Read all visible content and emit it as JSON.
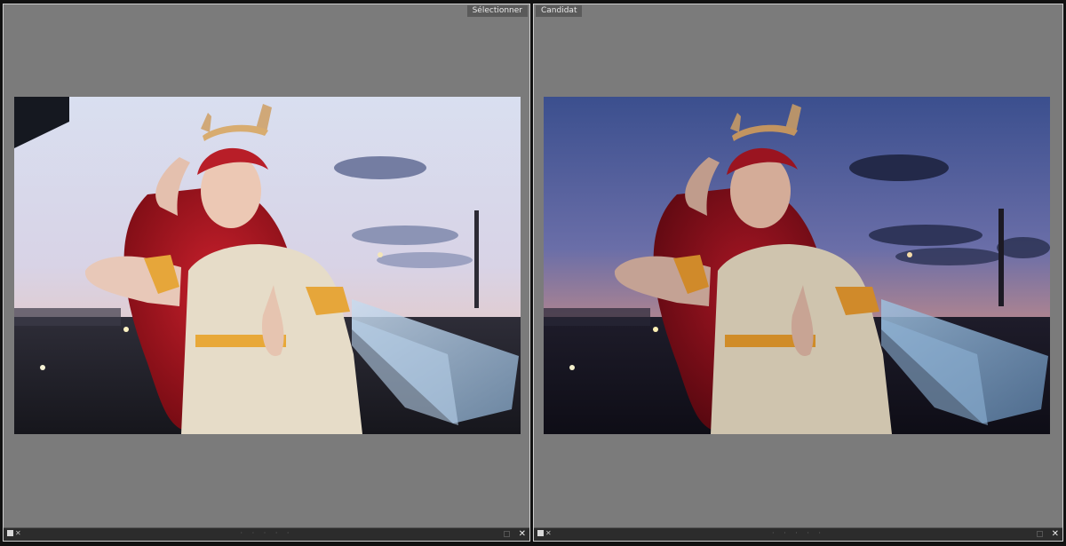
{
  "panes": {
    "left": {
      "label": "Sélectionner",
      "close_glyph": "✕",
      "flag_glyph": "✕",
      "dots": "· · · · ·"
    },
    "right": {
      "label": "Candidat",
      "close_glyph": "✕",
      "flag_glyph": "✕",
      "dots": "· · · · ·"
    }
  },
  "icons": {
    "flag": "flag-icon",
    "reject": "reject-x-icon",
    "rating_dots": "rating-dots-icon",
    "color_label": "color-label-icon",
    "close": "close-icon"
  },
  "colors": {
    "pane_bg": "#7b7b7b",
    "tag_bg": "#5a5a5a",
    "footer_bg": "#2c2c2c"
  }
}
